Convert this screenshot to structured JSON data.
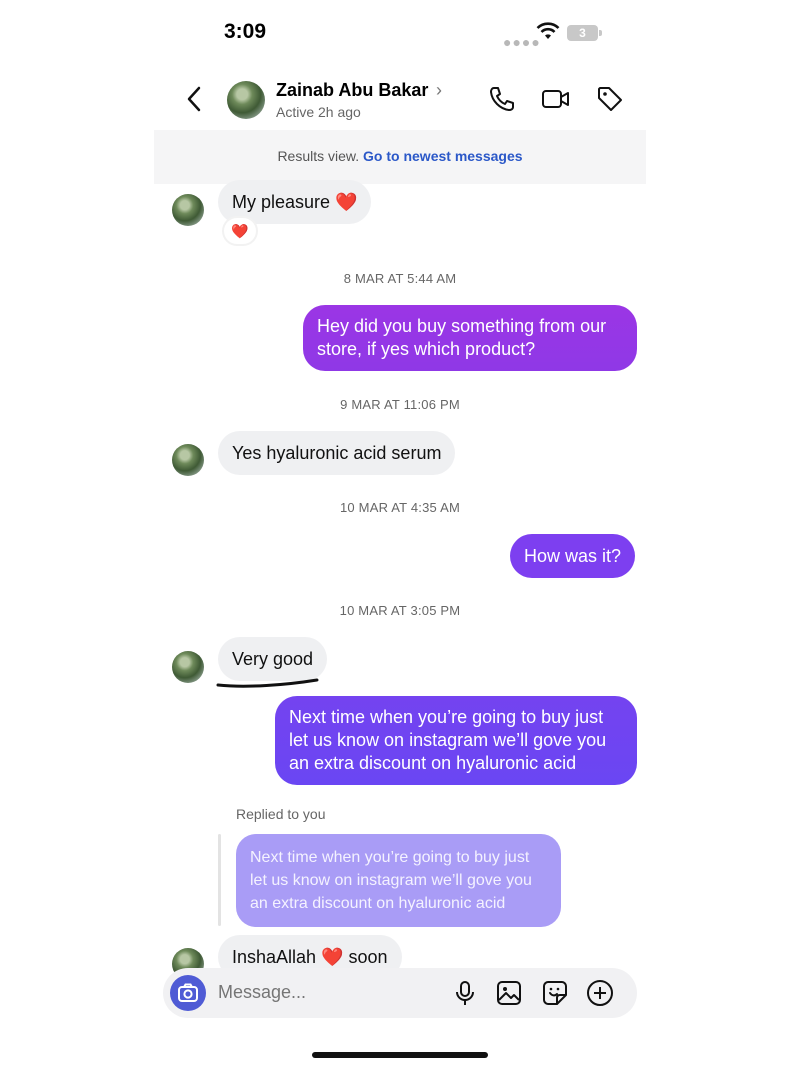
{
  "status_bar": {
    "time": "3:09",
    "battery": "3"
  },
  "header": {
    "contact_name": "Zainab Abu Bakar",
    "active_status": "Active 2h ago",
    "icons": [
      "back-icon",
      "phone-icon",
      "video-icon",
      "tag-icon"
    ]
  },
  "results_bar": {
    "text": "Results view.",
    "link": "Go to newest messages"
  },
  "messages": [
    {
      "from": "them",
      "text": "My pleasure",
      "emoji": "❤️",
      "reaction": "❤️"
    },
    {
      "type": "timestamp",
      "text": "8 MAR AT 5:44 AM"
    },
    {
      "from": "me",
      "lines": [
        "Hey did you buy something from our",
        "store, if yes which product?"
      ]
    },
    {
      "type": "timestamp",
      "text": "9 MAR AT 11:06 PM"
    },
    {
      "from": "them",
      "text": "Yes hyaluronic acid serum"
    },
    {
      "type": "timestamp",
      "text": "10 MAR AT 4:35 AM"
    },
    {
      "from": "me",
      "text": "How was it?"
    },
    {
      "type": "timestamp",
      "text": "10 MAR AT 3:05 PM"
    },
    {
      "from": "them",
      "text": "Very good"
    },
    {
      "from": "me",
      "lines": [
        "Next time when you’re going to buy just",
        "let us know on instagram we’ll gove you",
        "an extra discount on hyaluronic acid"
      ]
    },
    {
      "type": "reply",
      "label": "Replied to you",
      "quoted_lines": [
        "Next time when you’re going to buy just",
        "let us know on instagram we’ll gove you",
        "an extra discount on hyaluronic acid"
      ]
    },
    {
      "from": "them",
      "text_before": "InshaAllah",
      "emoji": "❤️",
      "text_after": "soon"
    }
  ],
  "composer": {
    "placeholder": "Message..."
  },
  "colors": {
    "outgoing_top": "#9b36e5",
    "outgoing_bottom": "#6f45f2",
    "link": "#2b58c8",
    "camera": "#4f5bd5"
  }
}
